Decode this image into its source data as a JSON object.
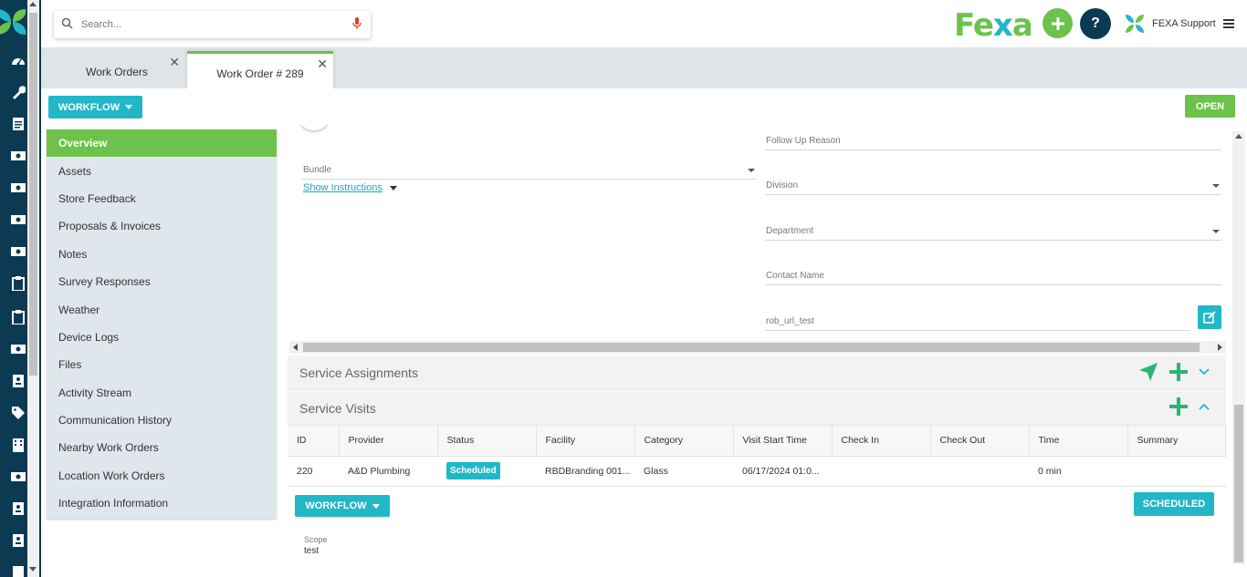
{
  "search": {
    "placeholder": "Search..."
  },
  "brand": {
    "prefix": "Fe",
    "x": "x",
    "suffix": "a"
  },
  "header": {
    "help_label": "?",
    "user_name": "FEXA Support"
  },
  "tabs": [
    {
      "label": "Work Orders"
    },
    {
      "label": "Work Order # 289"
    }
  ],
  "toolbar": {
    "workflow_label": "WORKFLOW",
    "status_label": "OPEN"
  },
  "sidenav": {
    "items": [
      {
        "label": "Overview"
      },
      {
        "label": "Assets"
      },
      {
        "label": "Store Feedback"
      },
      {
        "label": "Proposals & Invoices"
      },
      {
        "label": "Notes"
      },
      {
        "label": "Survey Responses"
      },
      {
        "label": "Weather"
      },
      {
        "label": "Device Logs"
      },
      {
        "label": "Files"
      },
      {
        "label": "Activity Stream"
      },
      {
        "label": "Communication History"
      },
      {
        "label": "Nearby Work Orders"
      },
      {
        "label": "Location Work Orders"
      },
      {
        "label": "Integration Information"
      }
    ]
  },
  "form": {
    "bundle_label": "Bundle",
    "show_instructions": "Show Instructions",
    "follow_up_reason_label": "Follow Up Reason",
    "division_label": "Division",
    "department_label": "Department",
    "contact_name_label": "Contact Name",
    "rob_url_test_label": "rob_url_test"
  },
  "sections": {
    "service_assignments": "Service Assignments",
    "service_visits": "Service Visits"
  },
  "visits_table": {
    "columns": [
      "ID",
      "Provider",
      "Status",
      "Facility",
      "Category",
      "Visit Start Time",
      "Check In",
      "Check Out",
      "Time",
      "Summary"
    ],
    "rows": [
      {
        "id": "220",
        "provider": "A&D Plumbing",
        "status": "Scheduled",
        "facility": "RBDBranding 001...",
        "category": "Glass",
        "visit_start": "06/17/2024 01:0...",
        "check_in": "",
        "check_out": "",
        "time": "0 min",
        "summary": ""
      }
    ]
  },
  "visit_actions": {
    "workflow_label": "WORKFLOW",
    "scheduled_label": "SCHEDULED"
  },
  "scope": {
    "label": "Scope",
    "value": "test"
  },
  "colors": {
    "brand_green": "#6cc24a",
    "teal": "#22b7c7",
    "navy": "#0b3a52"
  }
}
